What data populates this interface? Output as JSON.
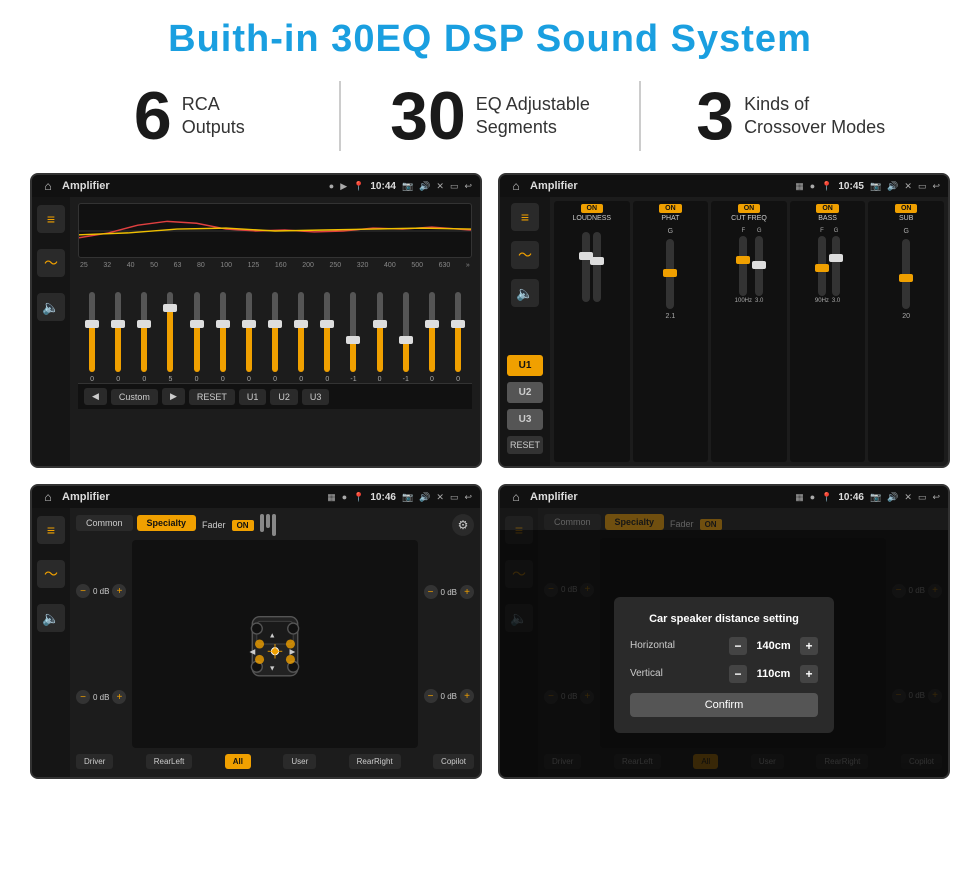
{
  "header": {
    "title": "Buith-in 30EQ DSP Sound System"
  },
  "stats": [
    {
      "number": "6",
      "line1": "RCA",
      "line2": "Outputs"
    },
    {
      "number": "30",
      "line1": "EQ Adjustable",
      "line2": "Segments"
    },
    {
      "number": "3",
      "line1": "Kinds of",
      "line2": "Crossover Modes"
    }
  ],
  "screens": [
    {
      "id": "screen1",
      "statusTitle": "Amplifier",
      "statusTime": "10:44",
      "type": "eq"
    },
    {
      "id": "screen2",
      "statusTitle": "Amplifier",
      "statusTime": "10:45",
      "type": "dsp"
    },
    {
      "id": "screen3",
      "statusTitle": "Amplifier",
      "statusTime": "10:46",
      "type": "specialty"
    },
    {
      "id": "screen4",
      "statusTitle": "Amplifier",
      "statusTime": "10:46",
      "type": "distance"
    }
  ],
  "eq": {
    "freqLabels": [
      "25",
      "32",
      "40",
      "50",
      "63",
      "80",
      "100",
      "125",
      "160",
      "200",
      "250",
      "320",
      "400",
      "500",
      "630"
    ],
    "sliderValues": [
      "0",
      "0",
      "0",
      "5",
      "0",
      "0",
      "0",
      "0",
      "0",
      "0",
      "-1",
      "0",
      "-1",
      ""
    ],
    "buttons": [
      "Custom",
      "RESET",
      "U1",
      "U2",
      "U3"
    ]
  },
  "dsp": {
    "channels": [
      "LOUDNESS",
      "PHAT",
      "CUT FREQ",
      "BASS",
      "SUB"
    ],
    "uButtons": [
      "U1",
      "U2",
      "U3"
    ],
    "resetLabel": "RESET"
  },
  "specialty": {
    "tabs": [
      "Common",
      "Specialty"
    ],
    "faderLabel": "Fader",
    "faderOn": "ON",
    "dbValues": [
      "0 dB",
      "0 dB",
      "0 dB",
      "0 dB"
    ],
    "bottomButtons": [
      "Driver",
      "RearLeft",
      "All",
      "User",
      "RearRight",
      "Copilot"
    ]
  },
  "distance": {
    "title": "Car speaker distance setting",
    "horizontal": {
      "label": "Horizontal",
      "value": "140cm"
    },
    "vertical": {
      "label": "Vertical",
      "value": "110cm"
    },
    "confirmLabel": "Confirm",
    "rightPanel": {
      "db1": "0 dB",
      "db2": "0 dB"
    },
    "bottomButtons": [
      "Driver",
      "RearLeft",
      "All",
      "User",
      "RearRight",
      "Copilot"
    ]
  }
}
